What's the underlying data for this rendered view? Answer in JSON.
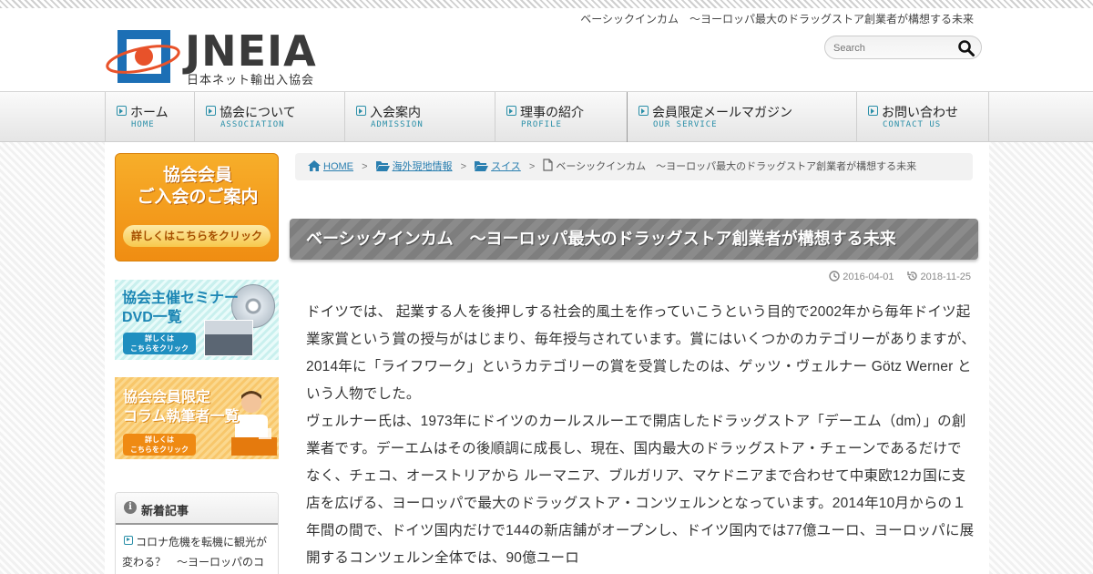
{
  "header": {
    "tagline": "ベーシックインカム　〜ヨーロッパ最大のドラッグストア創業者が構想する未来",
    "logo_text": "JNEIA",
    "logo_sub": "日本ネット輸出入協会",
    "search_placeholder": "Search"
  },
  "nav": [
    {
      "label": "ホーム",
      "sub": "HOME"
    },
    {
      "label": "協会について",
      "sub": "ASSOCIATION"
    },
    {
      "label": "入会案内",
      "sub": "ADMISSION"
    },
    {
      "label": "理事の紹介",
      "sub": "PROFILE"
    },
    {
      "label": "会員限定メールマガジン",
      "sub": "OUR SERVICE"
    },
    {
      "label": "お問い合わせ",
      "sub": "CONTACT US"
    }
  ],
  "sidebar": {
    "banner1": {
      "title_line1": "協会会員",
      "title_line2": "ご入会のご案内",
      "cta": "詳しくはこちらをクリック"
    },
    "banner2": {
      "title_line1": "協会主催セミナー",
      "title_line2": "DVD一覧",
      "cta_line1": "詳しくは",
      "cta_line2": "こちらをクリック"
    },
    "banner3": {
      "title_line1": "協会会員限定",
      "title_line2": "コラム執筆者一覧",
      "cta_line1": "詳しくは",
      "cta_line2": "こちらをクリック"
    },
    "widget": {
      "title": "新着記事",
      "item": "コロナ危機を転機に観光が変わる？　〜ヨーロッパのコ"
    }
  },
  "breadcrumb": {
    "home": "HOME",
    "level1": "海外現地情報",
    "level2": "スイス",
    "current": "ベーシックインカム　〜ヨーロッパ最大のドラッグストア創業者が構想する未来"
  },
  "post": {
    "title": "ベーシックインカム　〜ヨーロッパ最大のドラッグストア創業者が構想する未来",
    "published": "2016-04-01",
    "updated": "2018-11-25",
    "paragraph1": "ドイツでは、 起業する人を後押しする社会的風土を作っていこうという目的で2002年から毎年ドイツ起業家賞という賞の授与がはじまり、毎年授与されています。賞にはいくつかのカテゴリーがありますが、2014年に「ライフワーク」というカテゴリーの賞を受賞したのは、ゲッツ・ヴェルナー Götz Werner という人物でした。",
    "paragraph2": "ヴェルナー氏は、1973年にドイツのカールスルーエで開店したドラッグストア「デーエム（dm）」の創業者です。デーエムはその後順調に成長し、現在、国内最大のドラッグストア・チェーンであるだけでなく、チェコ、オーストリアから ルーマニア、ブルガリア、マケドニアまで合わせて中東欧12カ国に支店を広げる、ヨーロッパで最大のドラッグストア・コンツェルンとなっています。2014年10月からの１年間の間で、ドイツ国内だけで144の新店舗がオープンし、ドイツ国内では77億ユーロ、ヨーロッパに展開するコンツェルン全体では、90億ユーロ"
  },
  "colors": {
    "accent": "#2a8fa8",
    "link": "#2a7fb0",
    "title_bar": "#858585",
    "banner_orange": "#f08d12",
    "logo_blue": "#1c6fb5",
    "logo_red": "#e8522a"
  }
}
